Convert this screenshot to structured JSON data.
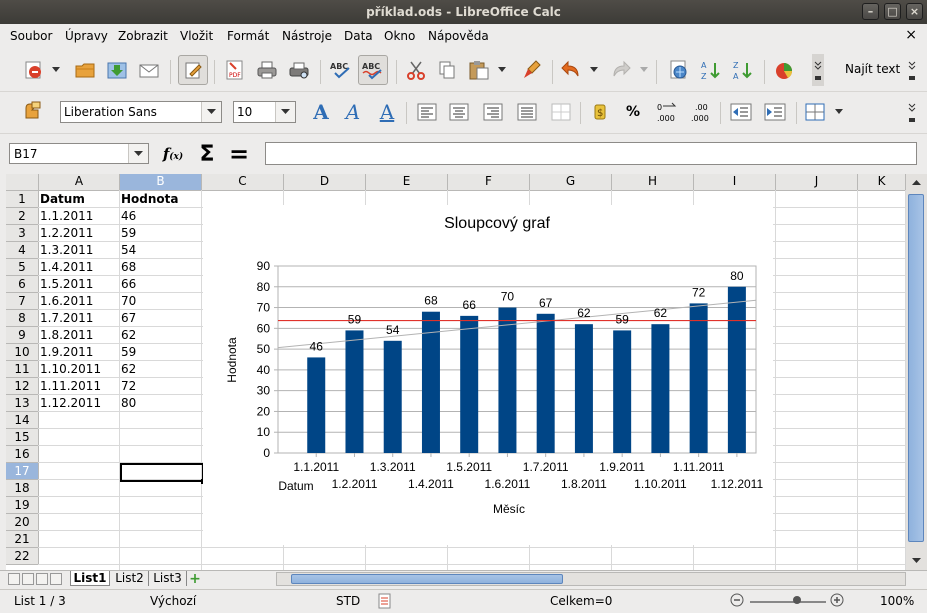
{
  "window": {
    "title": "příklad.ods - LibreOffice Calc"
  },
  "menu": [
    {
      "label": "Soubor"
    },
    {
      "label": "Úpravy"
    },
    {
      "label": "Zobrazit"
    },
    {
      "label": "Vložit"
    },
    {
      "label": "Formát"
    },
    {
      "label": "Nástroje"
    },
    {
      "label": "Data"
    },
    {
      "label": "Okno"
    },
    {
      "label": "Nápověda"
    }
  ],
  "toolbar": {
    "find_text": "Najít text",
    "font_name": "Liberation Sans",
    "font_size": "10"
  },
  "formula": {
    "name_box": "B17",
    "content": ""
  },
  "columns": [
    "A",
    "B",
    "C",
    "D",
    "E",
    "F",
    "G",
    "H",
    "I",
    "J",
    "K"
  ],
  "rows": [
    "1",
    "2",
    "3",
    "4",
    "5",
    "6",
    "7",
    "8",
    "9",
    "10",
    "11",
    "12",
    "13",
    "14",
    "15",
    "16",
    "17",
    "18",
    "19",
    "20",
    "21",
    "22"
  ],
  "selected": {
    "column": "B",
    "row": "17"
  },
  "table": {
    "headers": [
      "Datum",
      "Hodnota"
    ],
    "rows": [
      [
        "1.1.2011",
        "46"
      ],
      [
        "1.2.2011",
        "59"
      ],
      [
        "1.3.2011",
        "54"
      ],
      [
        "1.4.2011",
        "68"
      ],
      [
        "1.5.2011",
        "66"
      ],
      [
        "1.6.2011",
        "70"
      ],
      [
        "1.7.2011",
        "67"
      ],
      [
        "1.8.2011",
        "62"
      ],
      [
        "1.9.2011",
        "59"
      ],
      [
        "1.10.2011",
        "62"
      ],
      [
        "1.11.2011",
        "72"
      ],
      [
        "1.12.2011",
        "80"
      ]
    ]
  },
  "chart_data": {
    "type": "bar",
    "title": "Sloupcový graf",
    "xlabel": "Měsíc",
    "ylabel": "Hodnota",
    "category_axis_title": "Datum",
    "categories": [
      "1.1.2011",
      "1.2.2011",
      "1.3.2011",
      "1.4.2011",
      "1.5.2011",
      "1.6.2011",
      "1.7.2011",
      "1.8.2011",
      "1.9.2011",
      "1.10.2011",
      "1.11.2011",
      "1.12.2011"
    ],
    "series": [
      {
        "values": [
          46,
          59,
          54,
          68,
          66,
          70,
          67,
          62,
          59,
          62,
          72,
          80
        ],
        "color": "#004586"
      }
    ],
    "mean_line": {
      "value": 63.75,
      "color": "#e0322b"
    },
    "trend_line": {
      "from": 50.7,
      "to": 73.5,
      "color": "#b3b3b3"
    },
    "ylim": [
      0,
      90
    ],
    "yticks": [
      0,
      10,
      20,
      30,
      40,
      50,
      60,
      70,
      80,
      90
    ],
    "grid": true,
    "data_labels": true,
    "legend": "none"
  },
  "sheets": [
    "List1",
    "List2",
    "List3"
  ],
  "active_sheet": "List1",
  "status": {
    "sheet": "List 1 / 3",
    "style": "Výchozí",
    "mode": "STD",
    "sum": "Celkem=0",
    "zoom": "100%"
  }
}
